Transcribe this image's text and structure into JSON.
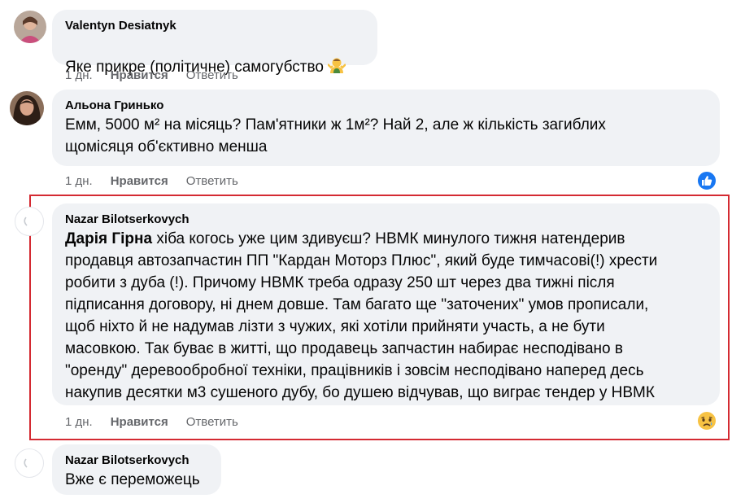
{
  "comments": [
    {
      "author": "Valentyn Desiatnyk",
      "text": "Яке прикре (політичне) самогубство",
      "emoji_icon": "man-shrugging-emoji",
      "time": "1 дн.",
      "like_label": "Нравится",
      "reply_label": "Ответить"
    },
    {
      "author": "Альона Гринько",
      "text": "Емм, 5000 м² на місяць? Пам'ятники ж 1м²? Най 2, але ж кількість загиблих\nщомісяця об'єктивно менша",
      "time": "1 дн.",
      "like_label": "Нравится",
      "reply_label": "Ответить",
      "reaction_icon": "like-reaction-icon"
    },
    {
      "author": "Nazar Bilotserkovych",
      "mention": "Дарія Гірна",
      "text": " хіба когось уже цим здивуєш? НВМК минулого тижня натендерив\nпродавця автозапчастин ПП \"Кардан Моторз Плюс\", який буде тимчасові(!) хрести\nробити з дуба (!). Причому НВМК треба одразу 250 шт через два тижні після\nпідписання договору, ні днем довше. Там багато ще \"заточених\" умов прописали,\nщоб ніхто й не надумав лізти з чужих, які хотіли прийняти участь, а не бути\nмасовкою. Так буває в житті, що продавець запчастин набирає несподівано в\n\"оренду\" деревообробної техніки, працівників і зовсім несподівано наперед десь\nнакупив десятки м3 сушеного дубу, бо душею відчував, що виграє тендер у НВМК",
      "time": "1 дн.",
      "like_label": "Нравится",
      "reply_label": "Ответить",
      "reaction_icon": "sad-reaction-icon"
    },
    {
      "author": "Nazar Bilotserkovych",
      "text": "Вже є переможець"
    }
  ],
  "colors": {
    "bubble": "#f0f2f5",
    "meta_text": "#65676b",
    "highlight_border": "#d42a32",
    "like_blue": "#1877f2"
  }
}
